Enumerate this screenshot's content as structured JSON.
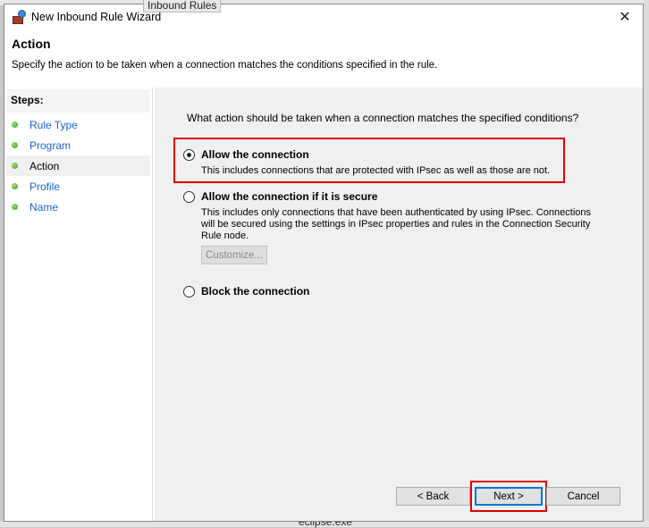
{
  "background": {
    "top_text": "Inbound Rules",
    "bottom_text": "eclipse.exe"
  },
  "window": {
    "title": "New Inbound Rule Wizard",
    "icon": "firewall-icon",
    "close_icon": "close-icon"
  },
  "header": {
    "title": "Action",
    "description": "Specify the action to be taken when a connection matches the conditions specified in the rule."
  },
  "steps": {
    "heading": "Steps:",
    "items": [
      {
        "label": "Rule Type",
        "current": false
      },
      {
        "label": "Program",
        "current": false
      },
      {
        "label": "Action",
        "current": true
      },
      {
        "label": "Profile",
        "current": false
      },
      {
        "label": "Name",
        "current": false
      }
    ]
  },
  "main": {
    "question": "What action should be taken when a connection matches the specified conditions?",
    "options": [
      {
        "label": "Allow the connection",
        "description": "This includes connections that are protected with IPsec as well as those are not.",
        "selected": true
      },
      {
        "label": "Allow the connection if it is secure",
        "description": "This includes only connections that have been authenticated by using IPsec.  Connections will be secured using the settings in IPsec properties and rules in the Connection Security Rule node.",
        "selected": false
      },
      {
        "label": "Block the connection",
        "description": "",
        "selected": false
      }
    ],
    "customize_label": "Customize..."
  },
  "buttons": {
    "back": "< Back",
    "next": "Next >",
    "cancel": "Cancel"
  },
  "colors": {
    "highlight": "#e00000",
    "focus": "#0078d7",
    "link": "#1a66cc"
  }
}
